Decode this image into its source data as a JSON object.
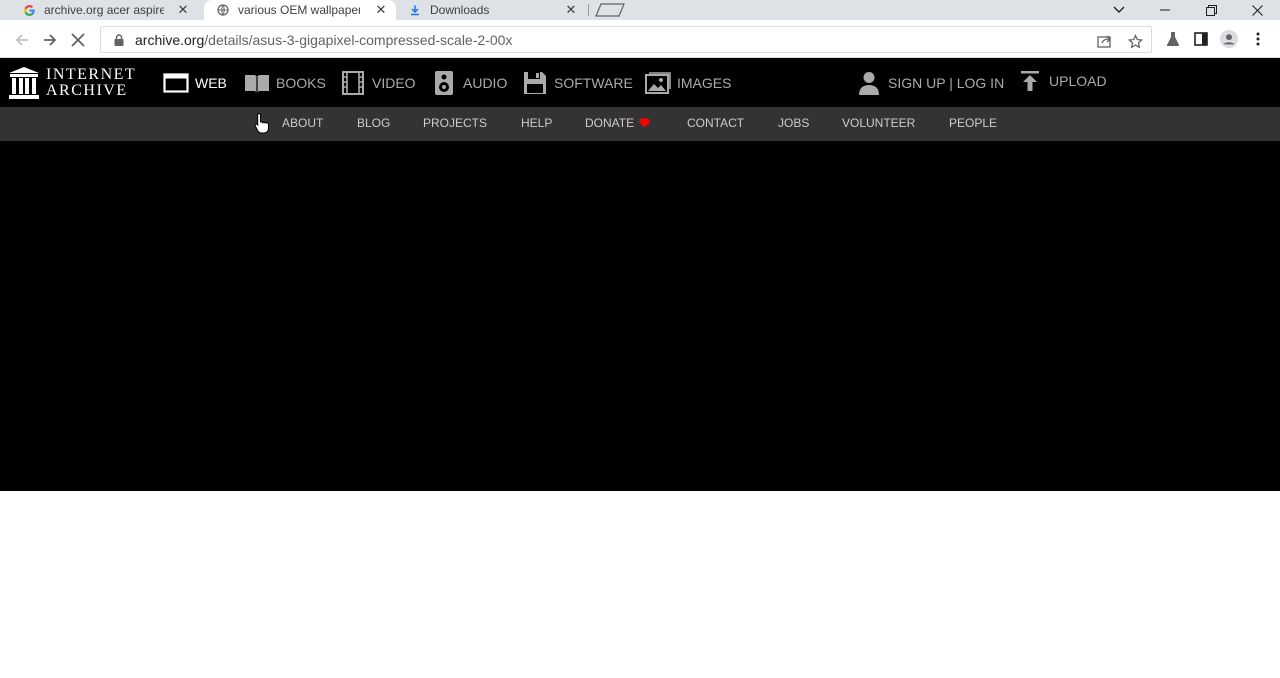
{
  "browser": {
    "tabs": [
      {
        "title": "archive.org acer aspire",
        "favicon": "google-icon"
      },
      {
        "title": "various OEM wallpaper",
        "favicon": "globe-icon"
      },
      {
        "title": "Downloads",
        "favicon": "download-icon"
      }
    ],
    "address": {
      "domain": "archive.org",
      "path": "/details/asus-3-gigapixel-compressed-scale-2-00x"
    },
    "colors": {
      "tabstrip": "#dee1e6",
      "accent": "#1a73e8"
    }
  },
  "ia": {
    "logo": {
      "line1": "INTERNET",
      "line2": "ARCHIVE"
    },
    "nav": [
      {
        "label": "WEB",
        "icon": "web-icon"
      },
      {
        "label": "BOOKS",
        "icon": "books-icon"
      },
      {
        "label": "VIDEO",
        "icon": "film-icon"
      },
      {
        "label": "AUDIO",
        "icon": "speaker-icon"
      },
      {
        "label": "SOFTWARE",
        "icon": "floppy-icon"
      },
      {
        "label": "IMAGES",
        "icon": "image-icon"
      }
    ],
    "account": {
      "label": "SIGN UP | LOG IN",
      "icon": "user-icon"
    },
    "upload": {
      "label": "UPLOAD",
      "icon": "upload-icon"
    },
    "subnav": [
      "ABOUT",
      "BLOG",
      "PROJECTS",
      "HELP",
      "DONATE",
      "CONTACT",
      "JOBS",
      "VOLUNTEER",
      "PEOPLE"
    ],
    "colors": {
      "top_bg": "#000000",
      "sub_bg": "#333333",
      "donate_heart": "#ff0000"
    }
  }
}
